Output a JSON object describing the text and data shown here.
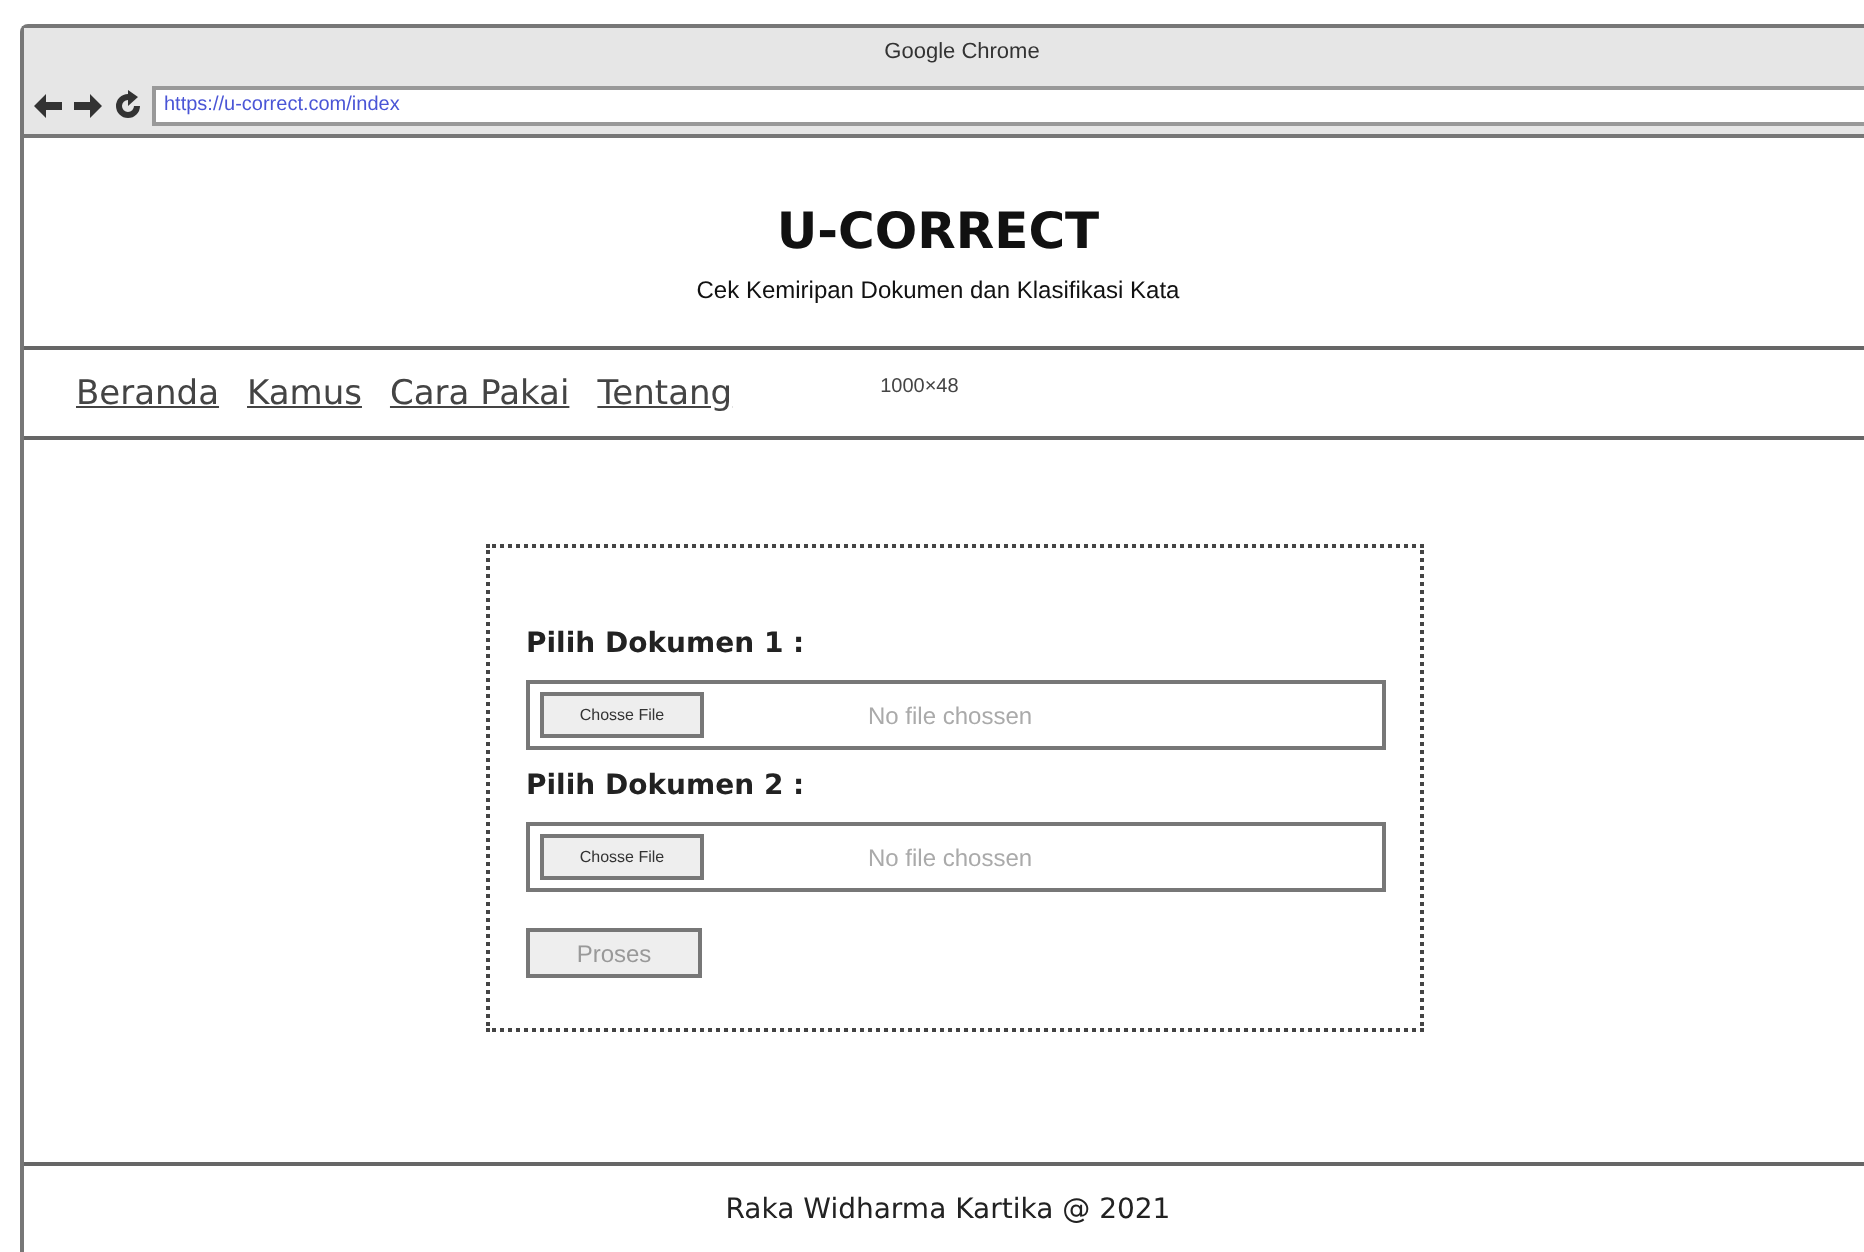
{
  "window": {
    "title": "Google Chrome",
    "url": "https://u-correct.com/index"
  },
  "header": {
    "title": "U-CORRECT",
    "subtitle": "Cek Kemiripan Dokumen dan Klasifikasi Kata"
  },
  "nav": {
    "items": [
      {
        "label": "Beranda"
      },
      {
        "label": "Kamus"
      },
      {
        "label": "Cara Pakai"
      },
      {
        "label": "Tentang"
      }
    ],
    "size_note": "1000×48"
  },
  "form": {
    "fields": [
      {
        "label": "Pilih Dokumen 1 :",
        "button": "Chosse File",
        "status": "No file chossen"
      },
      {
        "label": "Pilih Dokumen 2 :",
        "button": "Chosse File",
        "status": "No file chossen"
      }
    ],
    "submit": {
      "label": "Proses",
      "disabled": true
    }
  },
  "footer": {
    "text": "Raka Widharma Kartika @ 2021"
  }
}
